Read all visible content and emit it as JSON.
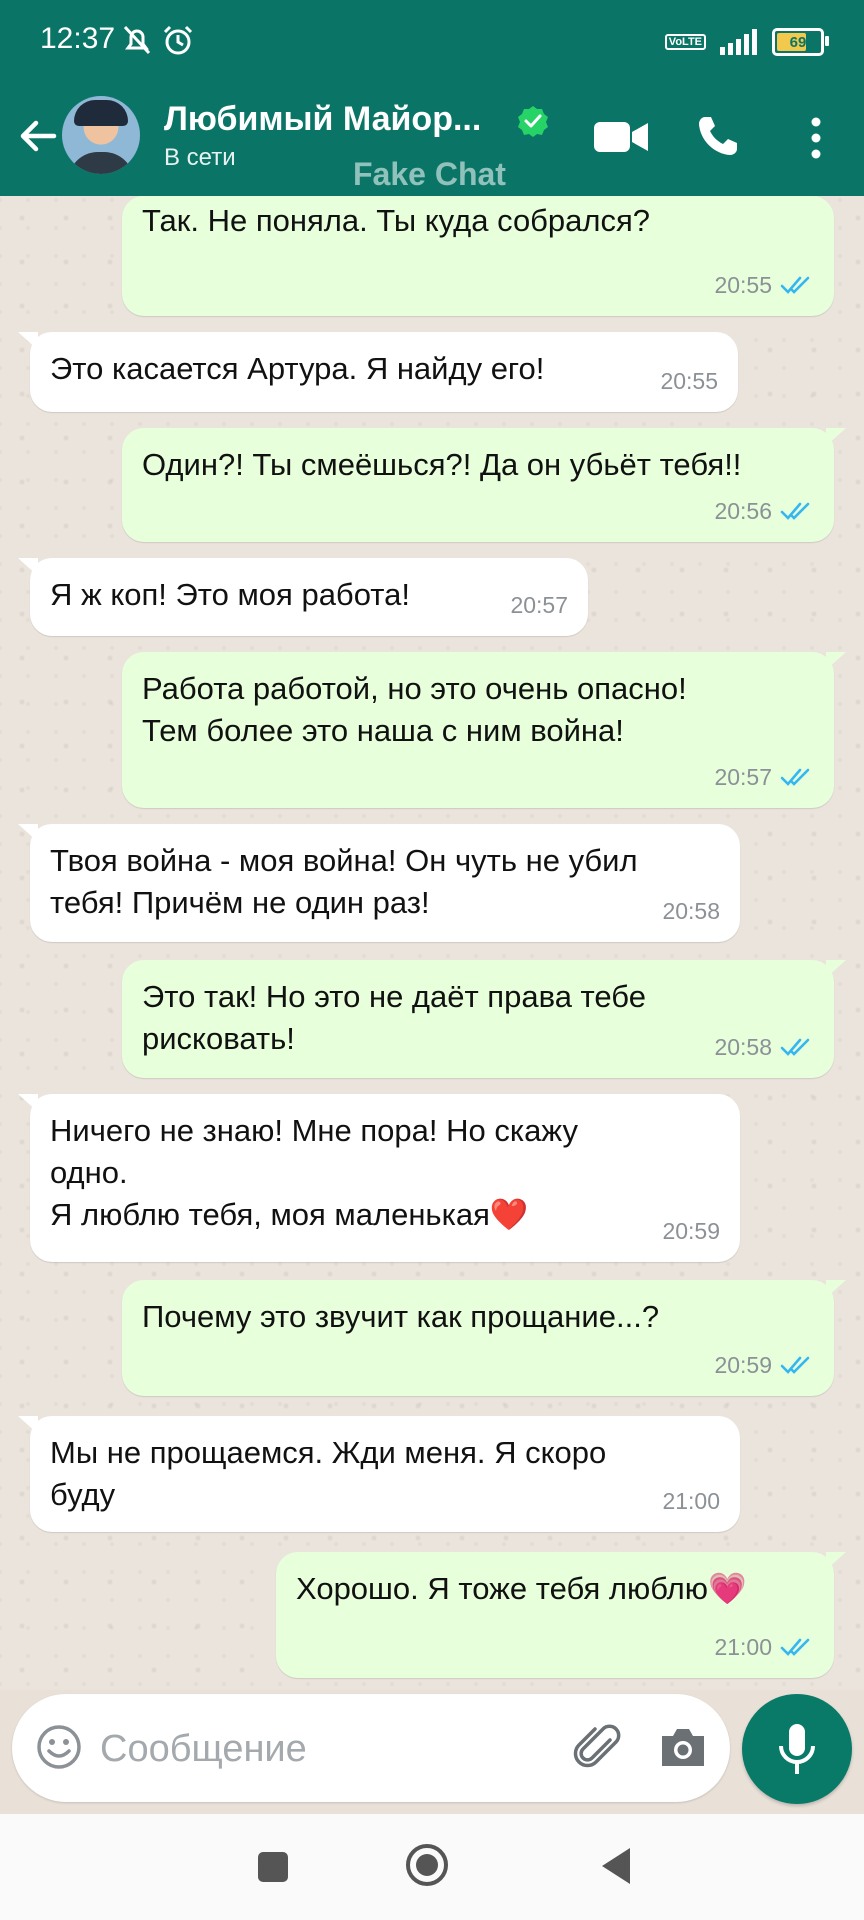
{
  "status_bar": {
    "time": "12:37",
    "battery": "69",
    "battery_level": 0.69,
    "network": "VoLTE"
  },
  "header": {
    "contact_name": "Любимый Майор...",
    "contact_status": "В сети",
    "watermark": "Fake Chat",
    "icons": [
      "back-arrow-icon",
      "verified-icon",
      "video-call-icon",
      "phone-icon",
      "more-menu-icon"
    ]
  },
  "messages": [
    {
      "dir": "out",
      "text": "Так. Не поняла. Ты куда собрался?",
      "time": "20:55",
      "read": true
    },
    {
      "dir": "in",
      "text": "Это касается Артура. Я найду его!",
      "time": "20:55"
    },
    {
      "dir": "out",
      "text": "Один?! Ты смеёшься?! Да он убьёт тебя!!",
      "time": "20:56",
      "read": true
    },
    {
      "dir": "in",
      "text": "Я ж коп! Это моя работа!",
      "time": "20:57"
    },
    {
      "dir": "out",
      "text": "Работа работой, но это очень опасно!\nТем более это наша с ним война!",
      "time": "20:57",
      "read": true
    },
    {
      "dir": "in",
      "text": "Твоя война - моя война! Он чуть не убил\nтебя! Причём не один раз!",
      "time": "20:58"
    },
    {
      "dir": "out",
      "text": "Это так! Но это не даёт права тебе\nрисковать!",
      "time": "20:58",
      "read": true
    },
    {
      "dir": "in",
      "text": "Ничего не знаю! Мне пора! Но скажу\nодно.\nЯ люблю тебя, моя маленькая❤️",
      "time": "20:59"
    },
    {
      "dir": "out",
      "text": "Почему это звучит как прощание...?",
      "time": "20:59",
      "read": true
    },
    {
      "dir": "in",
      "text": "Мы не прощаемся. Жди меня. Я скоро\nбуду",
      "time": "21:00"
    },
    {
      "dir": "out",
      "text": "Хорошо. Я тоже тебя люблю💗",
      "time": "21:00",
      "read": true
    }
  ],
  "input": {
    "placeholder": "Сообщение"
  },
  "colors": {
    "header": "#0a7566",
    "outgoing_bubble": "#e7ffdb",
    "incoming_bubble": "#ffffff",
    "read_ticks": "#34b7f1",
    "mic_button": "#0a7a68"
  }
}
